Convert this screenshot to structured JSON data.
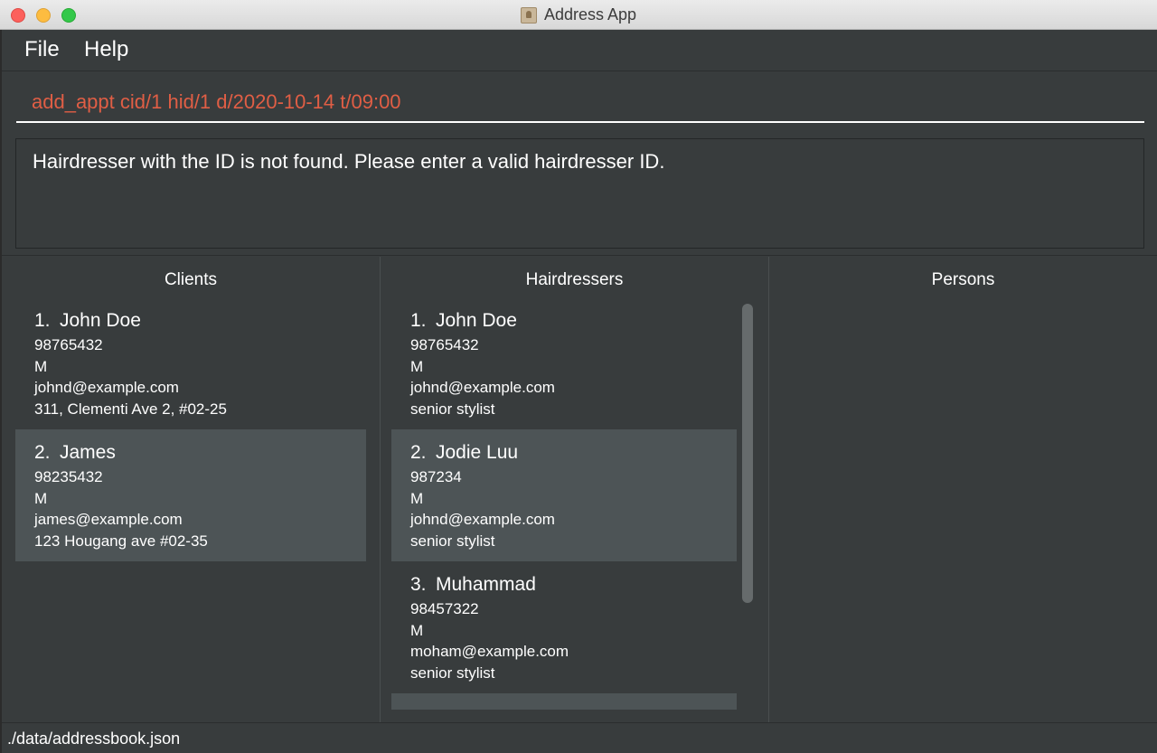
{
  "window": {
    "title": "Address App"
  },
  "menu": {
    "file": "File",
    "help": "Help"
  },
  "command": {
    "value": "add_appt cid/1 hid/1 d/2020-10-14 t/09:00"
  },
  "result": {
    "message": "Hairdresser with the ID is not found. Please enter a valid hairdresser ID."
  },
  "clients": {
    "heading": "Clients",
    "items": [
      {
        "index": "1.",
        "name": "John Doe",
        "phone": "98765432",
        "gender": "M",
        "email": "johnd@example.com",
        "detail": "311, Clementi Ave 2, #02-25"
      },
      {
        "index": "2.",
        "name": "James",
        "phone": "98235432",
        "gender": "M",
        "email": "james@example.com",
        "detail": "123 Hougang ave #02-35"
      }
    ]
  },
  "hairdressers": {
    "heading": "Hairdressers",
    "items": [
      {
        "index": "1.",
        "name": "John Doe",
        "phone": "98765432",
        "gender": "M",
        "email": "johnd@example.com",
        "detail": "senior stylist"
      },
      {
        "index": "2.",
        "name": "Jodie Luu",
        "phone": "987234",
        "gender": "M",
        "email": "johnd@example.com",
        "detail": "senior stylist"
      },
      {
        "index": "3.",
        "name": "Muhammad",
        "phone": "98457322",
        "gender": "M",
        "email": "moham@example.com",
        "detail": "senior stylist"
      }
    ]
  },
  "persons": {
    "heading": "Persons"
  },
  "status": {
    "path": "./data/addressbook.json"
  }
}
